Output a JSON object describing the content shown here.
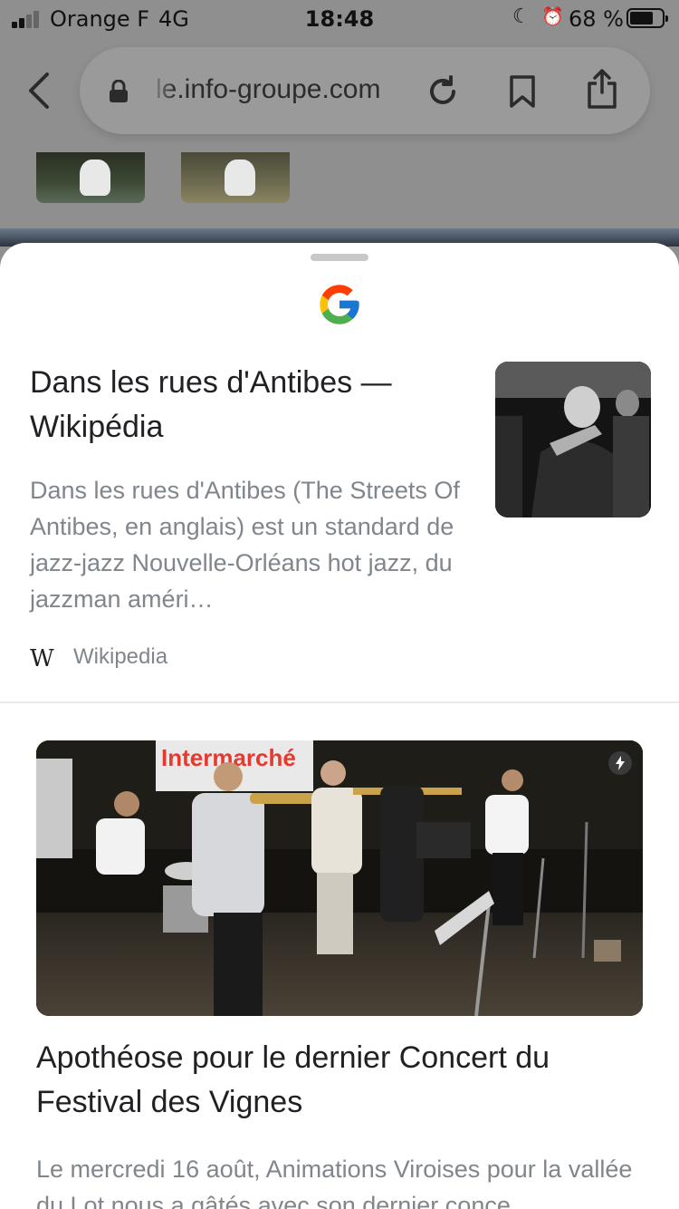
{
  "status_bar": {
    "carrier": "Orange F",
    "network": "4G",
    "time": "18:48",
    "battery_percent": "68 %"
  },
  "browser": {
    "url": "le.info-groupe.com"
  },
  "sheet": {
    "results": [
      {
        "title": "Dans les rues d'Antibes — Wikipédia",
        "snippet": "Dans les rues d'Antibes (The Streets Of Antibes, en anglais) est un standard de jazz-jazz Nouvelle-Orléans hot jazz, du jazzman améri…",
        "source_icon": "W",
        "source": "Wikipedia"
      },
      {
        "title": "Apothéose pour le dernier Concert du Festival des Vignes",
        "snippet": "Le mercredi 16 août, Animations Viroises pour la vallée du Lot nous a gâtés avec son dernier conce"
      }
    ],
    "news_image_sign": "Intermarché"
  }
}
